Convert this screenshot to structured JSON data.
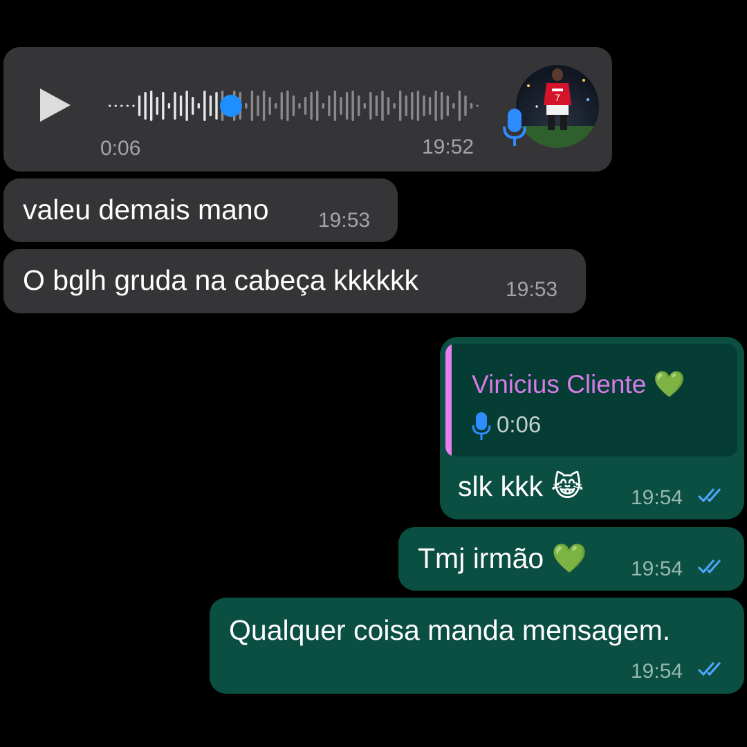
{
  "voice_message": {
    "duration": "0:06",
    "time": "19:52",
    "progress": 0.3,
    "avatar": "avatar-photo-red-jersey-number-7",
    "play_icon": "play-icon",
    "mic_icon": "microphone-icon"
  },
  "messages": [
    {
      "direction": "in",
      "text": "valeu demais mano",
      "time": "19:53"
    },
    {
      "direction": "in",
      "text": "O bglh gruda na cabeça kkkkkk",
      "time": "19:53"
    },
    {
      "direction": "out",
      "reply_to": {
        "name": "Vinicius Cliente 💚",
        "duration": "0:06",
        "icon": "microphone-icon"
      },
      "text": "slk kkk 😹",
      "time": "19:54",
      "status": "read"
    },
    {
      "direction": "out",
      "text": "Tmj irmão 💚",
      "time": "19:54",
      "status": "read"
    },
    {
      "direction": "out",
      "text": "Qualquer coisa manda mensagem.",
      "time": "19:54",
      "status": "read"
    }
  ],
  "colors": {
    "incoming_bubble": "#353537",
    "outgoing_bubble": "#0b4e42",
    "quote_bg": "#053d34",
    "quote_accent": "#e77ff0",
    "play_accent": "#1f8fff",
    "read_ticks": "#4fa8ff"
  }
}
